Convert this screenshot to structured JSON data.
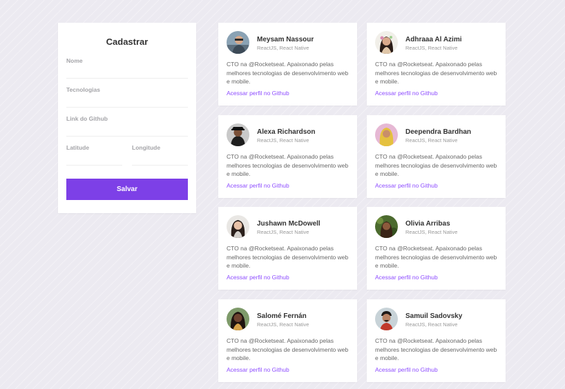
{
  "form": {
    "title": "Cadastrar",
    "fields": {
      "nome": {
        "label": "Nome",
        "value": ""
      },
      "tecnologias": {
        "label": "Tecnologias",
        "value": ""
      },
      "github": {
        "label": "Link do Github",
        "value": ""
      },
      "latitude": {
        "label": "Latitude",
        "value": ""
      },
      "longitude": {
        "label": "Longitude",
        "value": ""
      }
    },
    "submit_label": "Salvar"
  },
  "devs": [
    {
      "name": "Meysam Nassour",
      "techs": "ReactJS, React Native",
      "bio": "CTO na @Rocketseat. Apaixonado pelas melhores tecnologias de desenvolvimento web e mobile.",
      "link": "Acessar perfil no Github"
    },
    {
      "name": "Adhraaa Al Azimi",
      "techs": "ReactJS, React Native",
      "bio": "CTO na @Rocketseat. Apaixonado pelas melhores tecnologias de desenvolvimento web e mobile.",
      "link": "Acessar perfil no Github"
    },
    {
      "name": "Alexa Richardson",
      "techs": "ReactJS, React Native",
      "bio": "CTO na @Rocketseat. Apaixonado pelas melhores tecnologias de desenvolvimento web e mobile.",
      "link": "Acessar perfil no Github"
    },
    {
      "name": "Deependra Bardhan",
      "techs": "ReactJS, React Native",
      "bio": "CTO na @Rocketseat. Apaixonado pelas melhores tecnologias de desenvolvimento web e mobile.",
      "link": "Acessar perfil no Github"
    },
    {
      "name": "Jushawn McDowell",
      "techs": "ReactJS, React Native",
      "bio": "CTO na @Rocketseat. Apaixonado pelas melhores tecnologias de desenvolvimento web e mobile.",
      "link": "Acessar perfil no Github"
    },
    {
      "name": "Olivia Arribas",
      "techs": "ReactJS, React Native",
      "bio": "CTO na @Rocketseat. Apaixonado pelas melhores tecnologias de desenvolvimento web e mobile.",
      "link": "Acessar perfil no Github"
    },
    {
      "name": "Salomé Fernán",
      "techs": "ReactJS, React Native",
      "bio": "CTO na @Rocketseat. Apaixonado pelas melhores tecnologias de desenvolvimento web e mobile.",
      "link": "Acessar perfil no Github"
    },
    {
      "name": "Samuil Sadovsky",
      "techs": "ReactJS, React Native",
      "bio": "CTO na @Rocketseat. Apaixonado pelas melhores tecnologias de desenvolvimento web e mobile.",
      "link": "Acessar perfil no Github"
    }
  ],
  "colors": {
    "accent": "#7d40e7",
    "link": "#8e4dff",
    "background": "#eceaf1"
  }
}
